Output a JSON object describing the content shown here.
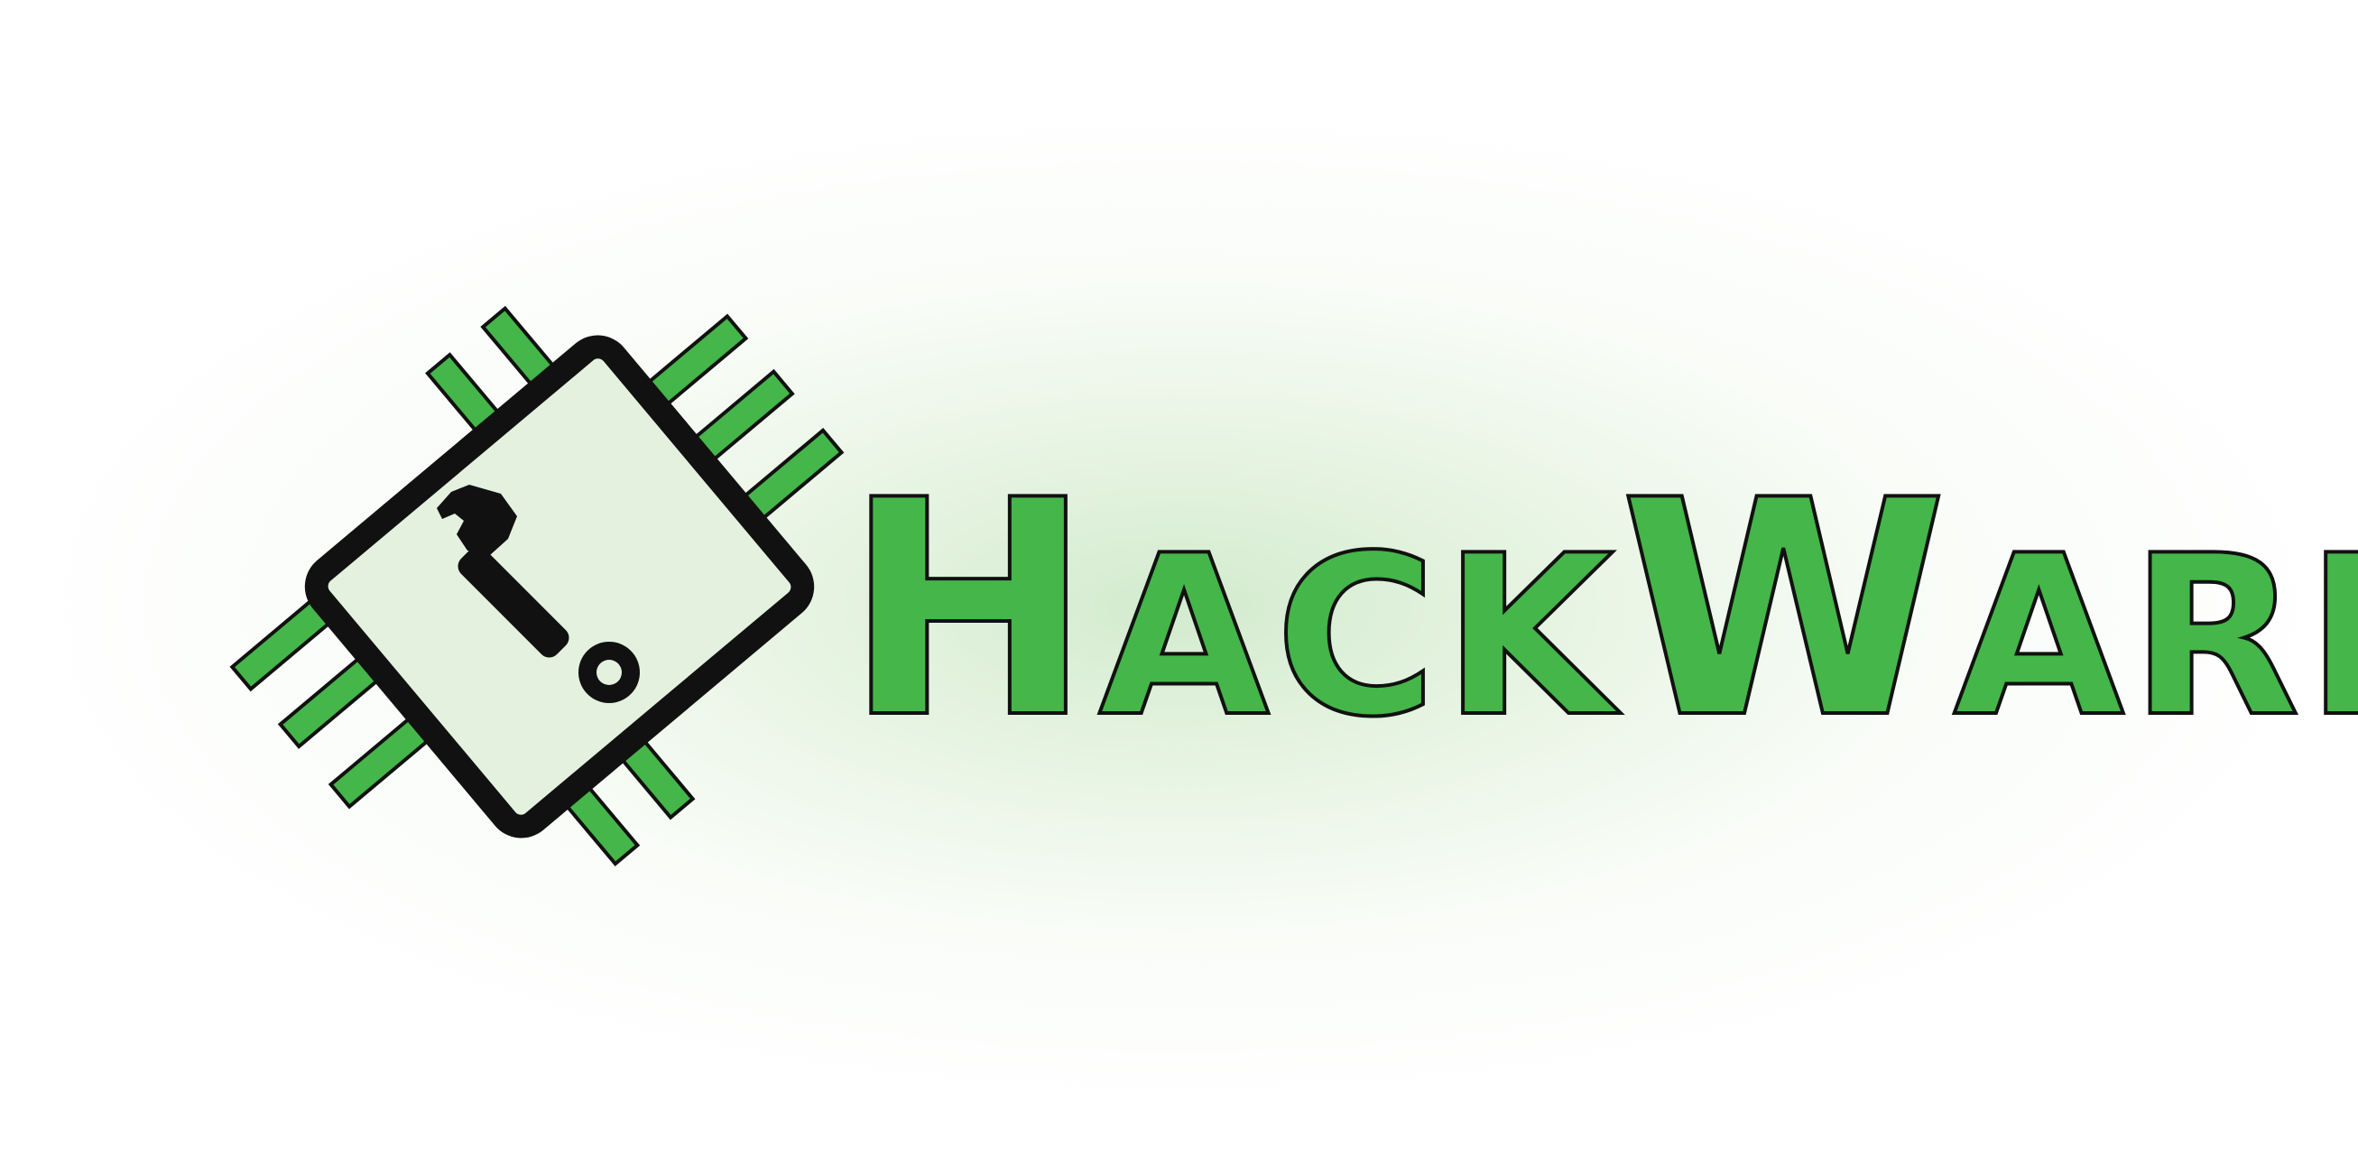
{
  "logo": {
    "word_parts": [
      {
        "text": "H",
        "style": "cap"
      },
      {
        "text": "ACK",
        "style": "small"
      },
      {
        "text": "W",
        "style": "cap"
      },
      {
        "text": "ARE",
        "style": "small"
      }
    ],
    "icons": {
      "chip": "microchip-icon",
      "tool": "wrench-icon"
    },
    "colors": {
      "green": "#45b649",
      "outline": "#111111",
      "glow": "#d8ecd2",
      "background": "#ffffff"
    }
  }
}
